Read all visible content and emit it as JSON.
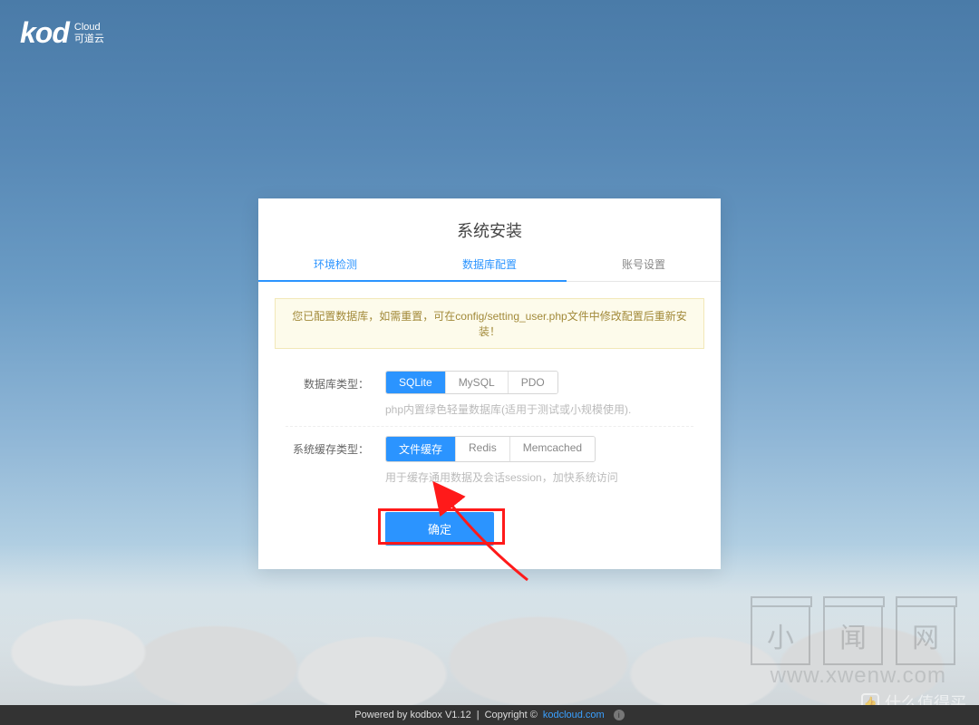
{
  "brand": {
    "mark": "kod",
    "cloud_en": "Cloud",
    "cloud_zh": "可道云"
  },
  "card": {
    "title": "系统安装",
    "tabs": {
      "env": "环境检测",
      "db": "数据库配置",
      "account": "账号设置"
    },
    "alert": "您已配置数据库，如需重置，可在config/setting_user.php文件中修改配置后重新安装！",
    "db": {
      "label": "数据库类型：",
      "options": {
        "sqlite": "SQLite",
        "mysql": "MySQL",
        "pdo": "PDO"
      },
      "hint": "php内置绿色轻量数据库(适用于测试或小规模使用)."
    },
    "cache": {
      "label": "系统缓存类型：",
      "options": {
        "file": "文件缓存",
        "redis": "Redis",
        "memcached": "Memcached"
      },
      "hint": "用于缓存通用数据及会话session，加快系统访问"
    },
    "submit": "确定"
  },
  "watermark": {
    "boxes": [
      "小",
      "闻",
      "网"
    ],
    "url": "www.xwenw.com",
    "brand_text": "什么值得买"
  },
  "footer": {
    "powered": "Powered by kodbox V1.12",
    "sep": "|",
    "copyright": "Copyright ©",
    "link": "kodcloud.com"
  }
}
